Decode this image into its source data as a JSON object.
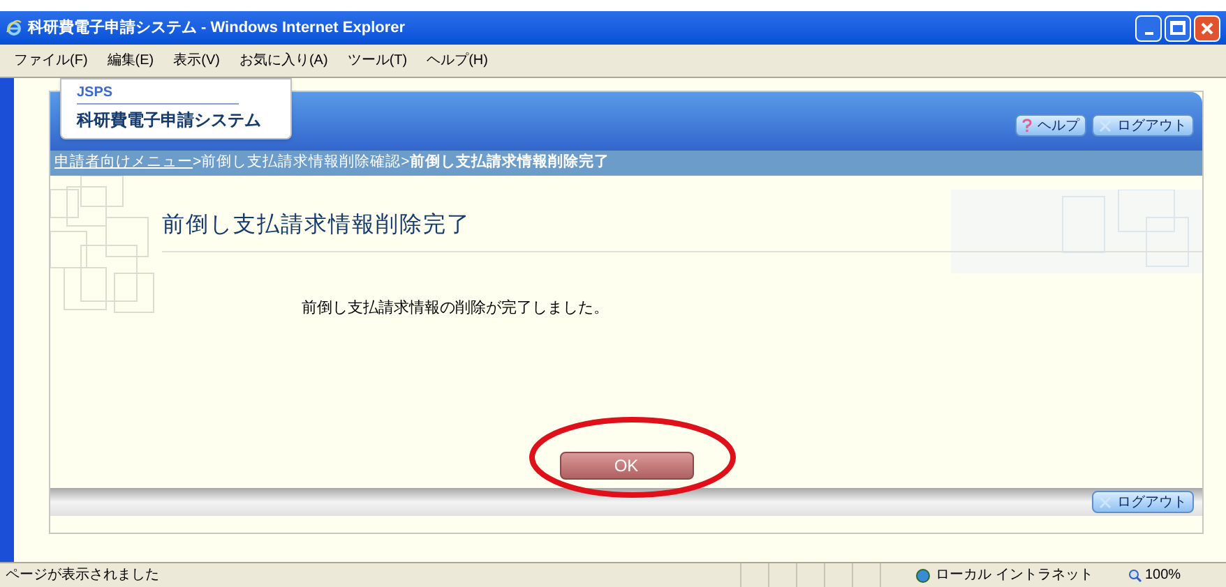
{
  "window": {
    "title": "科研費電子申請システム - Windows Internet Explorer"
  },
  "menu": [
    "ファイル(F)",
    "編集(E)",
    "表示(V)",
    "お気に入り(A)",
    "ツール(T)",
    "ヘルプ(H)"
  ],
  "logo": {
    "org": "JSPS",
    "name": "科研費電子申請システム"
  },
  "header_buttons": [
    {
      "kind": "help",
      "label": "ヘルプ"
    },
    {
      "kind": "logout",
      "label": "ログアウト"
    }
  ],
  "breadcrumb": [
    {
      "label": "申請者向けメニュー",
      "kind": "link"
    },
    {
      "label": ">前倒し支払請求情報削除確認>",
      "kind": "text"
    },
    {
      "label": "前倒し支払請求情報削除完了",
      "kind": "current"
    }
  ],
  "heading": "前倒し支払請求情報削除完了",
  "message": "前倒し支払請求情報の削除が完了しました。",
  "ok_button": {
    "label": "OK",
    "highlighted": true
  },
  "footer_buttons": [
    {
      "kind": "logout",
      "label": "ログアウト"
    }
  ],
  "status_bar": {
    "text": "ページが表示されました",
    "zone": "ローカル イントラネット",
    "zoom": "100%"
  }
}
